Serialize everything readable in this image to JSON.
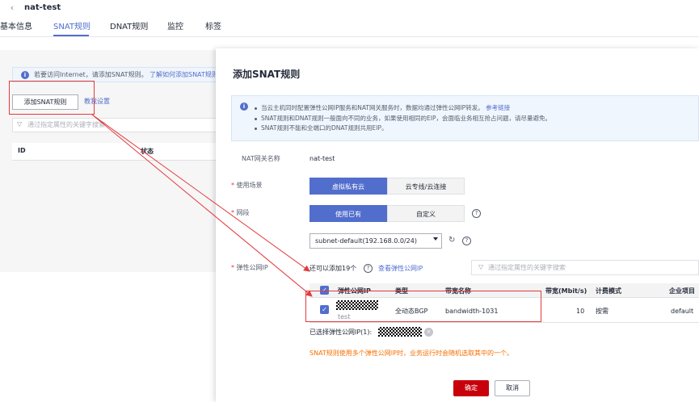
{
  "header": {
    "back_icon": "chevron-left-icon",
    "gateway_name": "nat-test",
    "tabs": [
      {
        "label": "基本信息",
        "active": false
      },
      {
        "label": "SNAT规则",
        "active": true
      },
      {
        "label": "DNAT规则",
        "active": false
      },
      {
        "label": "监控",
        "active": false
      },
      {
        "label": "标签",
        "active": false
      }
    ]
  },
  "background": {
    "info_text": "若要访问Internet，请添加SNAT规则。",
    "info_link": "了解如何添加SNAT规则",
    "add_button": "添加SNAT规则",
    "tutorial_link": "教我设置",
    "filter_placeholder": "通过指定属性的关键字搜索",
    "columns": [
      "ID",
      "状态"
    ]
  },
  "modal": {
    "title": "添加SNAT规则",
    "tips": [
      {
        "text": "当云主机同时配置弹性公网IP服务和NAT网关服务时，数据均通过弹性公网IP转发。",
        "link": "参考链接"
      },
      {
        "text": "SNAT规则和DNAT规则一般面向不同的业务，如果使用相同的EIP，会面临业务相互抢占问题，请尽量避免。",
        "link": ""
      },
      {
        "text": "SNAT规则不能和全端口的DNAT规则共用EIP。",
        "link": ""
      }
    ],
    "nat_gateway_label": "NAT网关名称",
    "nat_gateway_value": "nat-test",
    "scenario_label": "使用场景",
    "scenario_options": [
      "虚拟私有云",
      "云专线/云连接"
    ],
    "scenario_selected": "虚拟私有云",
    "subnet_label": "网段",
    "subnet_options": [
      "使用已有",
      "自定义"
    ],
    "subnet_selected": "使用已有",
    "subnet_select_value": "subnet-default(192.168.0.0/24)",
    "eip_label": "弹性公网IP",
    "eip_remaining": "还可以添加19个",
    "eip_view_link": "查看弹性公网IP",
    "eip_search_placeholder": "通过指定属性的关键字搜索",
    "table": {
      "columns": [
        "弹性公网IP",
        "类型",
        "带宽名称",
        "带宽(Mbit/s)",
        "计费模式",
        "企业项目"
      ],
      "rows": [
        {
          "eip": "",
          "eip_sub": "test",
          "type": "全动态BGP",
          "bandwidth_name": "bandwidth-1031",
          "bandwidth": "10",
          "billing": "按需",
          "project": "default",
          "checked": true
        }
      ]
    },
    "selected_label": "已选择弹性公网IP(1):",
    "warning": "SNAT规则使用多个弹性公网IP时，业务运行时会随机选取其中的一个。",
    "ok_button": "确定",
    "cancel_button": "取消"
  },
  "colors": {
    "primary": "#526ecc",
    "danger": "#c7000b",
    "annotation_red": "#e4393c",
    "warning": "#f66f00"
  }
}
